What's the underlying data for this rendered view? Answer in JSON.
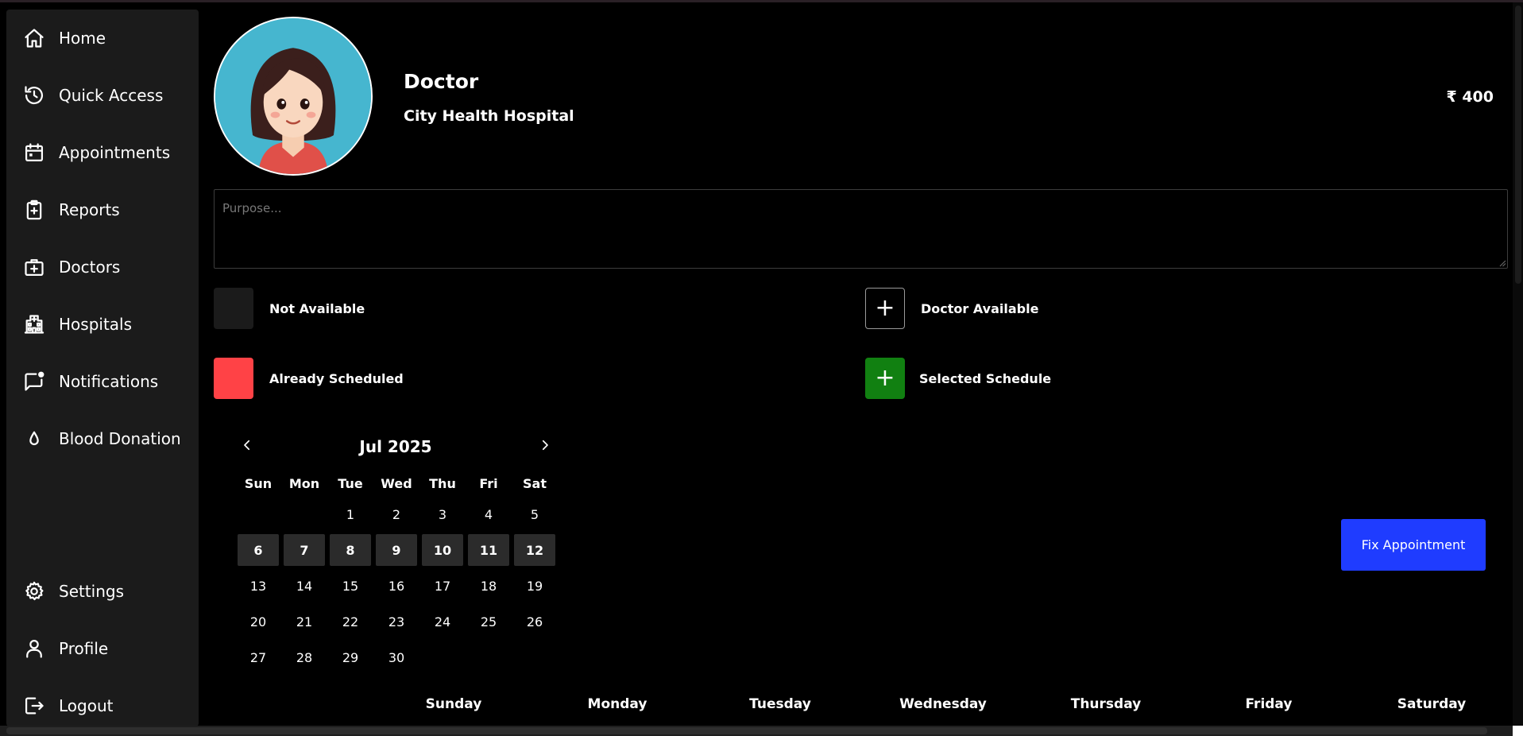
{
  "sidebar": {
    "items": [
      {
        "label": "Home",
        "icon": "home-icon"
      },
      {
        "label": "Quick Access",
        "icon": "history-icon"
      },
      {
        "label": "Appointments",
        "icon": "calendar-icon"
      },
      {
        "label": "Reports",
        "icon": "clipboard-plus-icon"
      },
      {
        "label": "Doctors",
        "icon": "medical-bag-icon"
      },
      {
        "label": "Hospitals",
        "icon": "hospital-building-icon"
      },
      {
        "label": "Notifications",
        "icon": "message-notification-icon"
      },
      {
        "label": "Blood Donation",
        "icon": "blood-drop-icon"
      }
    ],
    "bottom_items": [
      {
        "label": "Settings",
        "icon": "gear-icon"
      },
      {
        "label": "Profile",
        "icon": "user-icon"
      },
      {
        "label": "Logout",
        "icon": "logout-icon"
      }
    ]
  },
  "doctor": {
    "title": "Doctor",
    "hospital": "City Health Hospital",
    "price": "₹ 400"
  },
  "purpose": {
    "placeholder": "Purpose...",
    "value": ""
  },
  "legend": {
    "not_available": "Not Available",
    "doctor_available": "Doctor Available",
    "already_scheduled": "Already Scheduled",
    "selected_schedule": "Selected Schedule"
  },
  "calendar": {
    "month_label": "Jul 2025",
    "weekdays": [
      "Sun",
      "Mon",
      "Tue",
      "Wed",
      "Thu",
      "Fri",
      "Sat"
    ],
    "weeks": [
      [
        "",
        "",
        "1",
        "2",
        "3",
        "4",
        "5"
      ],
      [
        "6",
        "7",
        "8",
        "9",
        "10",
        "11",
        "12"
      ],
      [
        "13",
        "14",
        "15",
        "16",
        "17",
        "18",
        "19"
      ],
      [
        "20",
        "21",
        "22",
        "23",
        "24",
        "25",
        "26"
      ],
      [
        "27",
        "28",
        "29",
        "30",
        "",
        "",
        ""
      ]
    ],
    "highlighted_week_index": 1
  },
  "actions": {
    "fix_appointment": "Fix Appointment"
  },
  "week_view": {
    "days": [
      "Sunday",
      "Monday",
      "Tuesday",
      "Wednesday",
      "Thursday",
      "Friday",
      "Saturday"
    ]
  },
  "colors": {
    "accent_blue": "#1f3cff",
    "not_available": "#1b1b1b",
    "already_scheduled": "#ff4246",
    "selected_schedule": "#118011",
    "sidebar_bg": "#1b1b1b"
  }
}
